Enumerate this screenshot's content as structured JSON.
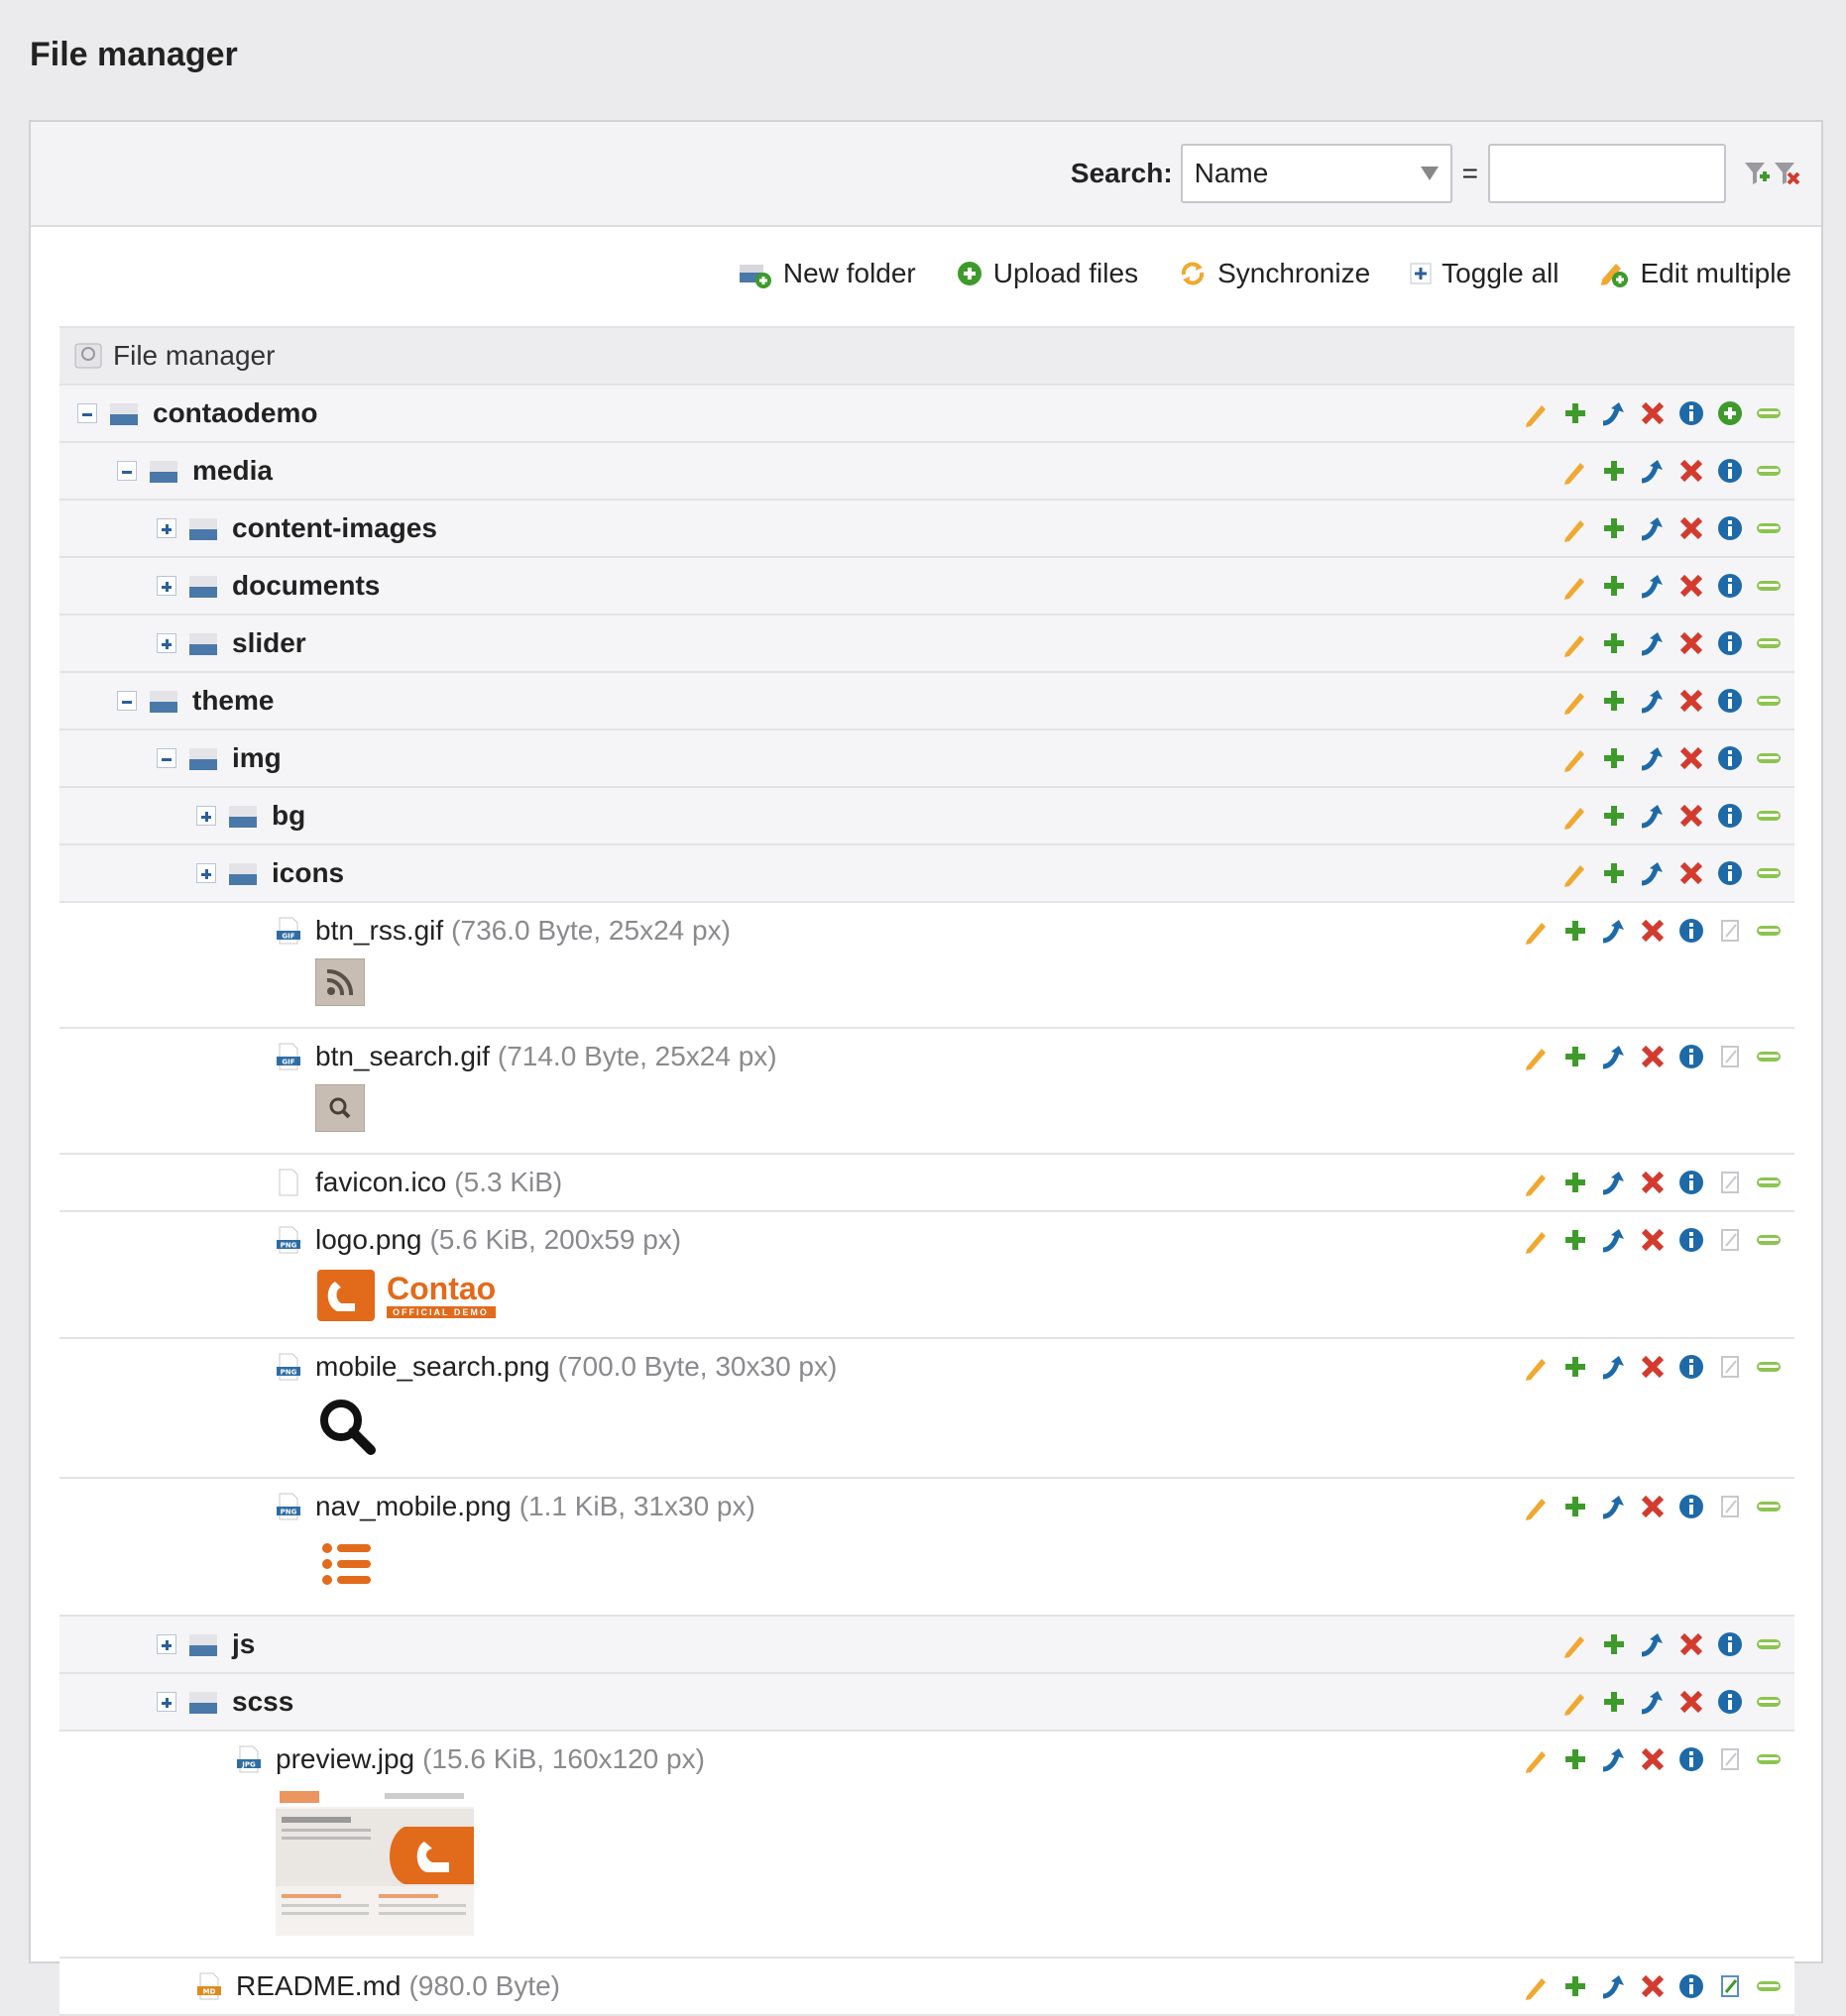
{
  "page": {
    "title": "File manager"
  },
  "search": {
    "label": "Search:",
    "field": "Name",
    "operator": "=",
    "value": ""
  },
  "toolbar": {
    "new_folder": "New folder",
    "upload_files": "Upload files",
    "synchronize": "Synchronize",
    "toggle_all": "Toggle all",
    "edit_multiple": "Edit multiple"
  },
  "tree": {
    "root_label": "File manager",
    "rows": [
      {
        "type": "folder",
        "name": "contaodemo",
        "level": 0,
        "state": "expanded",
        "upload_action": true
      },
      {
        "type": "folder",
        "name": "media",
        "level": 1,
        "state": "expanded"
      },
      {
        "type": "folder",
        "name": "content-images",
        "level": 2,
        "state": "collapsed"
      },
      {
        "type": "folder",
        "name": "documents",
        "level": 2,
        "state": "collapsed"
      },
      {
        "type": "folder",
        "name": "slider",
        "level": 2,
        "state": "collapsed"
      },
      {
        "type": "folder",
        "name": "theme",
        "level": 1,
        "state": "expanded"
      },
      {
        "type": "folder",
        "name": "img",
        "level": 2,
        "state": "expanded"
      },
      {
        "type": "folder",
        "name": "bg",
        "level": 3,
        "state": "collapsed"
      },
      {
        "type": "folder",
        "name": "icons",
        "level": 3,
        "state": "collapsed"
      },
      {
        "type": "file",
        "name": "btn_rss.gif",
        "meta": "(736.0 Byte, 25x24 px)",
        "ext": "GIF",
        "thumb": "rss"
      },
      {
        "type": "file",
        "name": "btn_search.gif",
        "meta": "(714.0 Byte, 25x24 px)",
        "ext": "GIF",
        "thumb": "search"
      },
      {
        "type": "file",
        "name": "favicon.ico",
        "meta": "(5.3 KiB)",
        "ext": "",
        "thumb": ""
      },
      {
        "type": "file",
        "name": "logo.png",
        "meta": "(5.6 KiB, 200x59 px)",
        "ext": "PNG",
        "thumb": "logo"
      },
      {
        "type": "file",
        "name": "mobile_search.png",
        "meta": "(700.0 Byte, 30x30 px)",
        "ext": "PNG",
        "thumb": "magnifier"
      },
      {
        "type": "file",
        "name": "nav_mobile.png",
        "meta": "(1.1 KiB, 31x30 px)",
        "ext": "PNG",
        "thumb": "list"
      },
      {
        "type": "folder",
        "name": "js",
        "level": 2,
        "state": "collapsed"
      },
      {
        "type": "folder",
        "name": "scss",
        "level": 2,
        "state": "collapsed"
      },
      {
        "type": "file",
        "name": "preview.jpg",
        "meta": "(15.6 KiB, 160x120 px)",
        "ext": "JPG",
        "thumb": "preview"
      },
      {
        "type": "file",
        "name": "README.md",
        "meta": "(980.0 Byte)",
        "ext": "MD",
        "thumb": ""
      }
    ]
  },
  "thumb_text": {
    "logo_word": "Contao",
    "logo_sub": "OFFICIAL DEMO"
  },
  "colors": {
    "edit": "#f0a830",
    "add": "#3f9a2c",
    "move": "#1e6aa8",
    "delete": "#d23b2e",
    "info": "#1e6aa8",
    "toggle": "#8cc44f"
  }
}
